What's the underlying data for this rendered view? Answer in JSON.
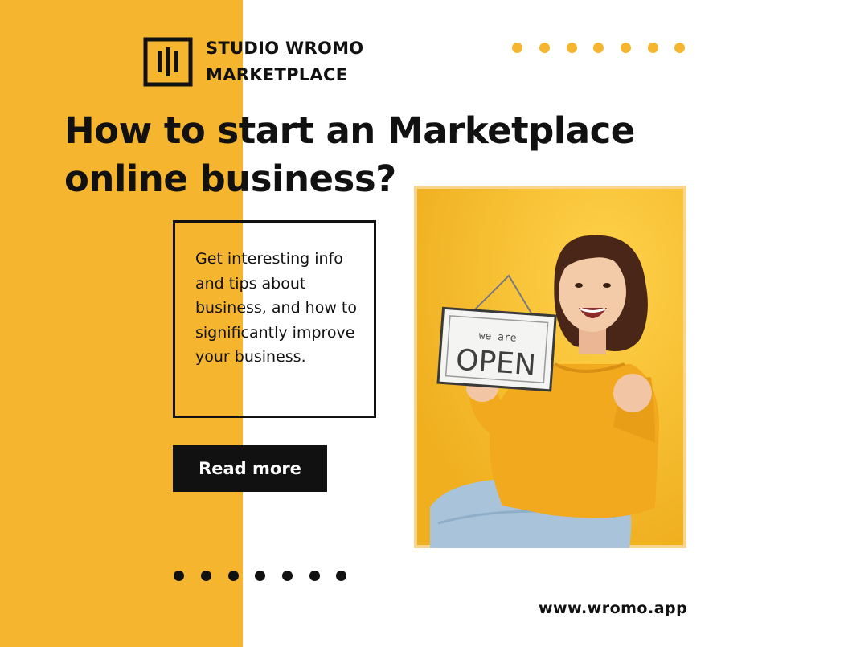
{
  "colors": {
    "accent": "#F6B52E",
    "text": "#111111",
    "background": "#FFFFFF"
  },
  "brand": {
    "logo_icon": "bars-logo-icon",
    "line1": "STUDIO WROMO",
    "line2": "MARKETPLACE"
  },
  "headline": {
    "line1": "How to start an Marketplace",
    "line2": "online business?"
  },
  "info": {
    "text": "Get interesting info and tips about business, and how to significantly improve your business."
  },
  "cta": {
    "label": "Read more"
  },
  "photo": {
    "sign_small": "we are",
    "sign_large": "OPEN"
  },
  "footer": {
    "website": "www.wromo.app"
  }
}
